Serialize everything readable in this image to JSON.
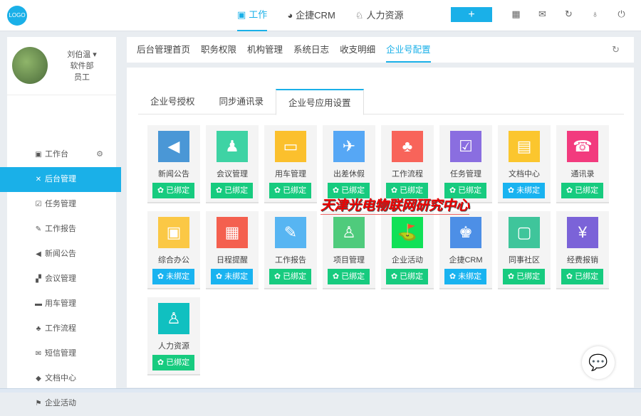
{
  "header": {
    "logo": "LOGO",
    "nav": [
      {
        "icon": "▣",
        "label": "工作",
        "active": true
      },
      {
        "icon": "◕",
        "label": "企捷CRM"
      },
      {
        "icon": "♘",
        "label": "人力资源"
      }
    ],
    "add_label": "+",
    "icons": [
      "▦",
      "✉",
      "↻",
      "♁",
      "⏻"
    ]
  },
  "profile": {
    "name": "刘伯温 ▾",
    "dept": "软件部",
    "role": "员工"
  },
  "sidebar": {
    "items": [
      {
        "icon": "▣",
        "label": "工作台"
      },
      {
        "icon": "✕",
        "label": "后台管理",
        "active": true
      },
      {
        "icon": "☑",
        "label": "任务管理"
      },
      {
        "icon": "✎",
        "label": "工作报告"
      },
      {
        "icon": "◀",
        "label": "新闻公告"
      },
      {
        "icon": "▞",
        "label": "会议管理"
      },
      {
        "icon": "▬",
        "label": "用车管理"
      },
      {
        "icon": "♣",
        "label": "工作流程"
      },
      {
        "icon": "✉",
        "label": "短信管理"
      },
      {
        "icon": "◆",
        "label": "文档中心"
      },
      {
        "icon": "⚑",
        "label": "企业活动"
      }
    ],
    "gear": "⚙"
  },
  "subnav": {
    "items": [
      "后台管理首页",
      "职务权限",
      "机构管理",
      "系统日志",
      "收支明细",
      "企业号配置"
    ],
    "active": 5,
    "refresh": "↻"
  },
  "tabs": [
    "企业号授权",
    "同步通讯录",
    "企业号应用设置"
  ],
  "status_labels": {
    "bound": "已绑定",
    "unbound": "未绑定"
  },
  "apps": [
    {
      "name": "新闻公告",
      "icon": "◀",
      "color": "#4a97d6",
      "status": "已绑定"
    },
    {
      "name": "会议管理",
      "icon": "♟",
      "color": "#3ed3a4",
      "status": "已绑定"
    },
    {
      "name": "用车管理",
      "icon": "▭",
      "color": "#fbc02d",
      "status": "已绑定"
    },
    {
      "name": "出差休假",
      "icon": "✈",
      "color": "#56a7f5",
      "status": "已绑定"
    },
    {
      "name": "工作流程",
      "icon": "♣",
      "color": "#f8645a",
      "status": "已绑定"
    },
    {
      "name": "任务管理",
      "icon": "☑",
      "color": "#8a6ee0",
      "status": "已绑定"
    },
    {
      "name": "文档中心",
      "icon": "▤",
      "color": "#fbc62e",
      "status": "未绑定"
    },
    {
      "name": "通讯录",
      "icon": "☎",
      "color": "#f23b7e",
      "status": "已绑定"
    },
    {
      "name": "综合办公",
      "icon": "▣",
      "color": "#fbc845",
      "status": "未绑定"
    },
    {
      "name": "日程提醒",
      "icon": "▦",
      "color": "#f4604f",
      "status": "未绑定"
    },
    {
      "name": "工作报告",
      "icon": "✎",
      "color": "#57b5f2",
      "status": "已绑定"
    },
    {
      "name": "项目管理",
      "icon": "♙",
      "color": "#4fcb7c",
      "status": "已绑定"
    },
    {
      "name": "企业活动",
      "icon": "⛳",
      "color": "#11e157",
      "status": "已绑定"
    },
    {
      "name": "企捷CRM",
      "icon": "♚",
      "color": "#4d8fe6",
      "status": "未绑定"
    },
    {
      "name": "同事社区",
      "icon": "▢",
      "color": "#3fc59b",
      "status": "已绑定"
    },
    {
      "name": "经费报销",
      "icon": "¥",
      "color": "#7b63d8",
      "status": "已绑定"
    },
    {
      "name": "人力资源",
      "icon": "♙",
      "color": "#10c0c0",
      "status": "已绑定"
    }
  ],
  "colors": {
    "accent": "#1ab0e8",
    "bound": "#17cb7f",
    "unbound": "#19b3f0"
  },
  "watermark": "天津光电物联网研究中心",
  "chat_icon": "💬"
}
